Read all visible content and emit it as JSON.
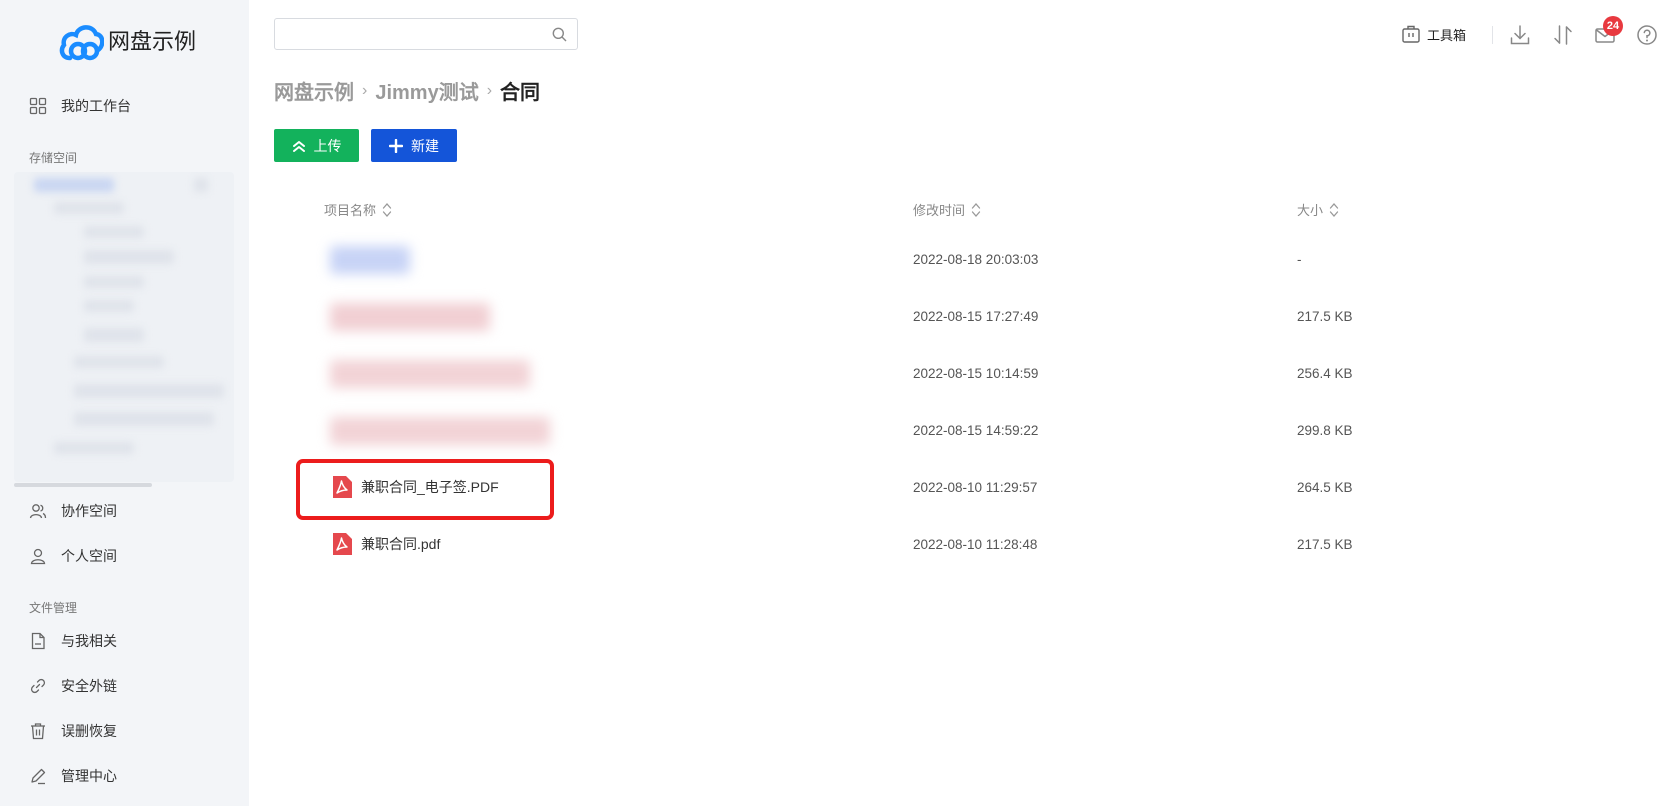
{
  "app": {
    "logo_text": "网盘示例"
  },
  "sidebar": {
    "workbench": "我的工作台",
    "storage_section": "存储空间",
    "collab_space": "协作空间",
    "personal_space": "个人空间",
    "file_section": "文件管理",
    "related_to_me": "与我相关",
    "secure_links": "安全外链",
    "recycle": "误删恢复",
    "admin": "管理中心"
  },
  "search": {
    "value": "",
    "placeholder": ""
  },
  "topbar": {
    "toolbox_label": "工具箱",
    "mail_badge": "24"
  },
  "breadcrumb": {
    "items": [
      "网盘示例",
      "Jimmy测试",
      "合同"
    ],
    "separator": "›"
  },
  "actions": {
    "upload_label": "上传",
    "new_label": "新建"
  },
  "table": {
    "headers": {
      "name": "项目名称",
      "modified": "修改时间",
      "size": "大小"
    },
    "rows": [
      {
        "name": "",
        "modified": "2022-08-18 20:03:03",
        "size": "-"
      },
      {
        "name": "",
        "modified": "2022-08-15 17:27:49",
        "size": "217.5 KB"
      },
      {
        "name": "",
        "modified": "2022-08-15 10:14:59",
        "size": "256.4 KB"
      },
      {
        "name": "",
        "modified": "2022-08-15 14:59:22",
        "size": "299.8 KB"
      },
      {
        "name": "兼职合同_电子签.PDF",
        "modified": "2022-08-10 11:29:57",
        "size": "264.5 KB"
      },
      {
        "name": "兼职合同.pdf",
        "modified": "2022-08-10 11:28:48",
        "size": "217.5 KB"
      }
    ]
  },
  "colors": {
    "upload_button": "#13b25c",
    "new_button": "#1455d9",
    "highlight_border": "#ec1c1c",
    "pdf_icon": "#e5484d",
    "logo": "#1a8cff",
    "badge": "#e8393f"
  }
}
